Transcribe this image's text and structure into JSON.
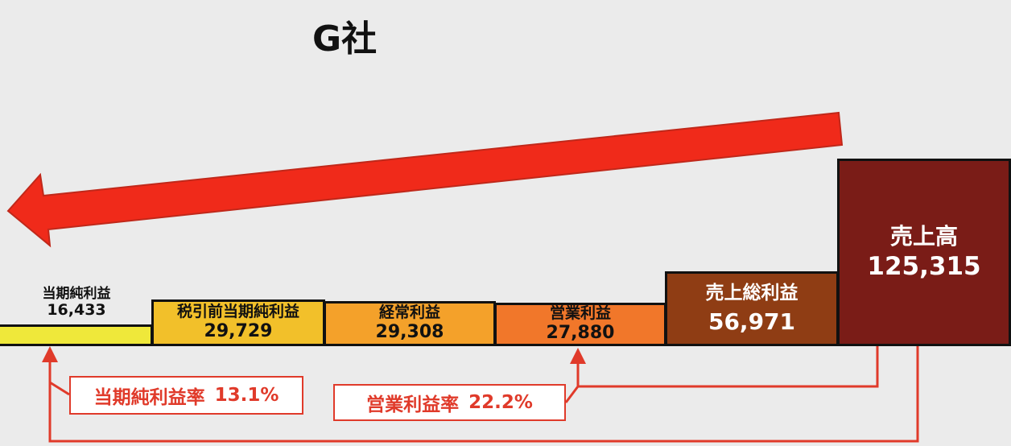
{
  "title": "G社",
  "bars": {
    "net_income": {
      "label": "当期純利益",
      "value": "16,433"
    },
    "pretax_income": {
      "label": "税引前当期純利益",
      "value": "29,729"
    },
    "ordinary_income": {
      "label": "経常利益",
      "value": "29,308"
    },
    "operating_income": {
      "label": "営業利益",
      "value": "27,880"
    },
    "gross_profit": {
      "label": "売上総利益",
      "value": "56,971"
    },
    "sales": {
      "label": "売上高",
      "value": "125,315"
    }
  },
  "ratios": {
    "net_margin": {
      "label": "当期純利益率",
      "value": "13.1%"
    },
    "operating_margin": {
      "label": "営業利益率",
      "value": "22.2%"
    }
  },
  "colors": {
    "arrow": "#f02a1a",
    "connector": "#e03a2a",
    "net": "#efe83a",
    "pretax": "#f2c02a",
    "ordinary": "#f4a12a",
    "operating": "#f1772a",
    "gross": "#8f3d14",
    "sales": "#7a1c17"
  }
}
